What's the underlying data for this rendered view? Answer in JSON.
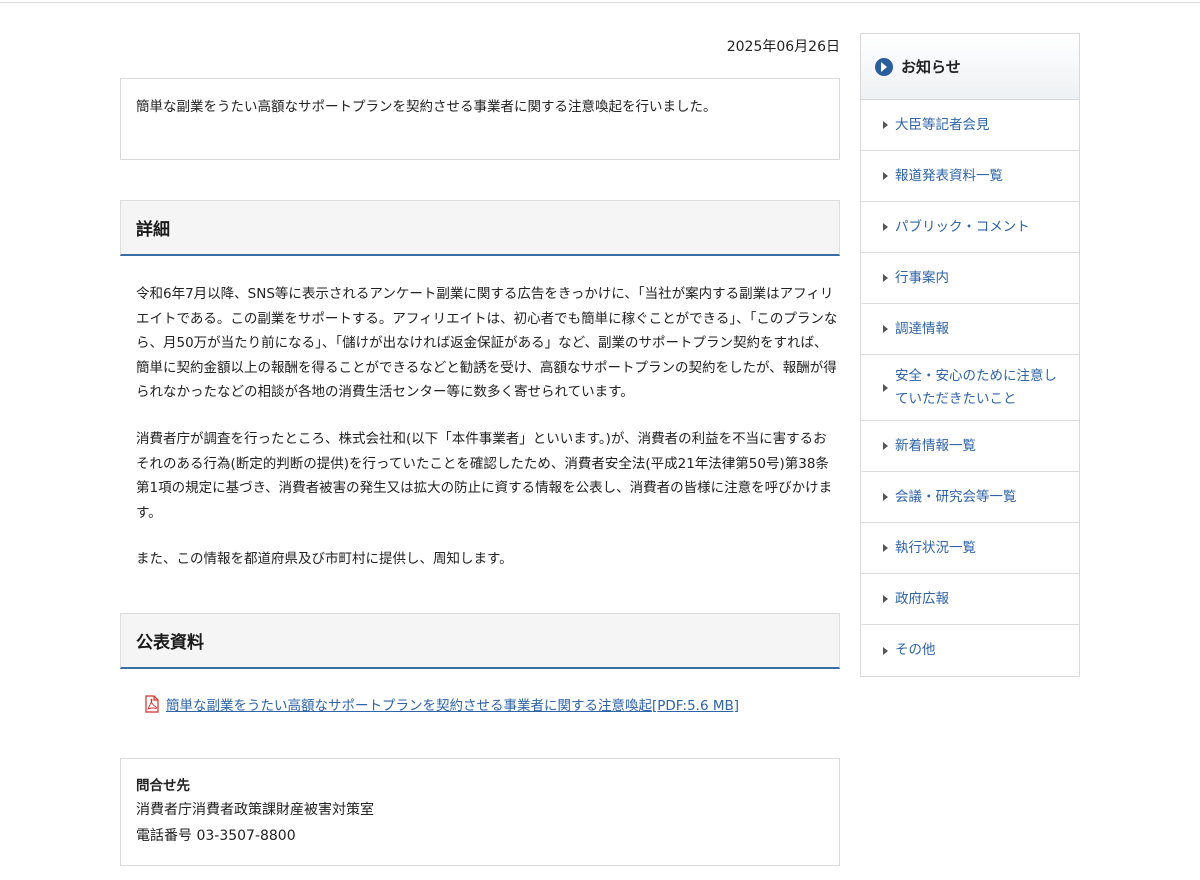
{
  "date": "2025年06月26日",
  "summary": "簡単な副業をうたい高額なサポートプランを契約させる事業者に関する注意喚起を行いました。",
  "detail": {
    "heading": "詳細",
    "paragraphs": [
      "令和6年7月以降、SNS等に表示されるアンケート副業に関する広告をきっかけに、「当社が案内する副業はアフィリエイトである。この副業をサポートする。アフィリエイトは、初心者でも簡単に稼ぐことができる」、「このプランなら、月50万が当たり前になる」、「儲けが出なければ返金保証がある」など、副業のサポートプラン契約をすれば、簡単に契約金額以上の報酬を得ることができるなどと勧誘を受け、高額なサポートプランの契約をしたが、報酬が得られなかったなどの相談が各地の消費生活センター等に数多く寄せられています。",
      "消費者庁が調査を行ったところ、株式会社和(以下「本件事業者」といいます。)が、消費者の利益を不当に害するおそれのある行為(断定的判断の提供)を行っていたことを確認したため、消費者安全法(平成21年法律第50号)第38条第1項の規定に基づき、消費者被害の発生又は拡大の防止に資する情報を公表し、消費者の皆様に注意を呼びかけます。",
      "また、この情報を都道府県及び市町村に提供し、周知します。"
    ]
  },
  "documents": {
    "heading": "公表資料",
    "link_label": "簡単な副業をうたい高額なサポートプランを契約させる事業者に関する注意喚起[PDF:5.6 MB]"
  },
  "contact": {
    "title": "問合せ先",
    "department": "消費者庁消費者政策課財産被害対策室",
    "phone": "電話番号 03-3507-8800"
  },
  "sidebar": {
    "title": "お知らせ",
    "items": [
      {
        "label": "大臣等記者会見"
      },
      {
        "label": "報道発表資料一覧"
      },
      {
        "label": "パブリック・コメント"
      },
      {
        "label": "行事案内"
      },
      {
        "label": "調達情報"
      },
      {
        "label": "安全・安心のために注意していただきたいこと"
      },
      {
        "label": "新着情報一覧"
      },
      {
        "label": "会議・研究会等一覧"
      },
      {
        "label": "執行状況一覧"
      },
      {
        "label": "政府広報"
      },
      {
        "label": "その他"
      }
    ]
  },
  "colors": {
    "link": "#2f64a8",
    "accent": "#3a6ea5",
    "sidebar_icon": "#2b5f9c",
    "pdf_icon": "#d32f2f"
  }
}
